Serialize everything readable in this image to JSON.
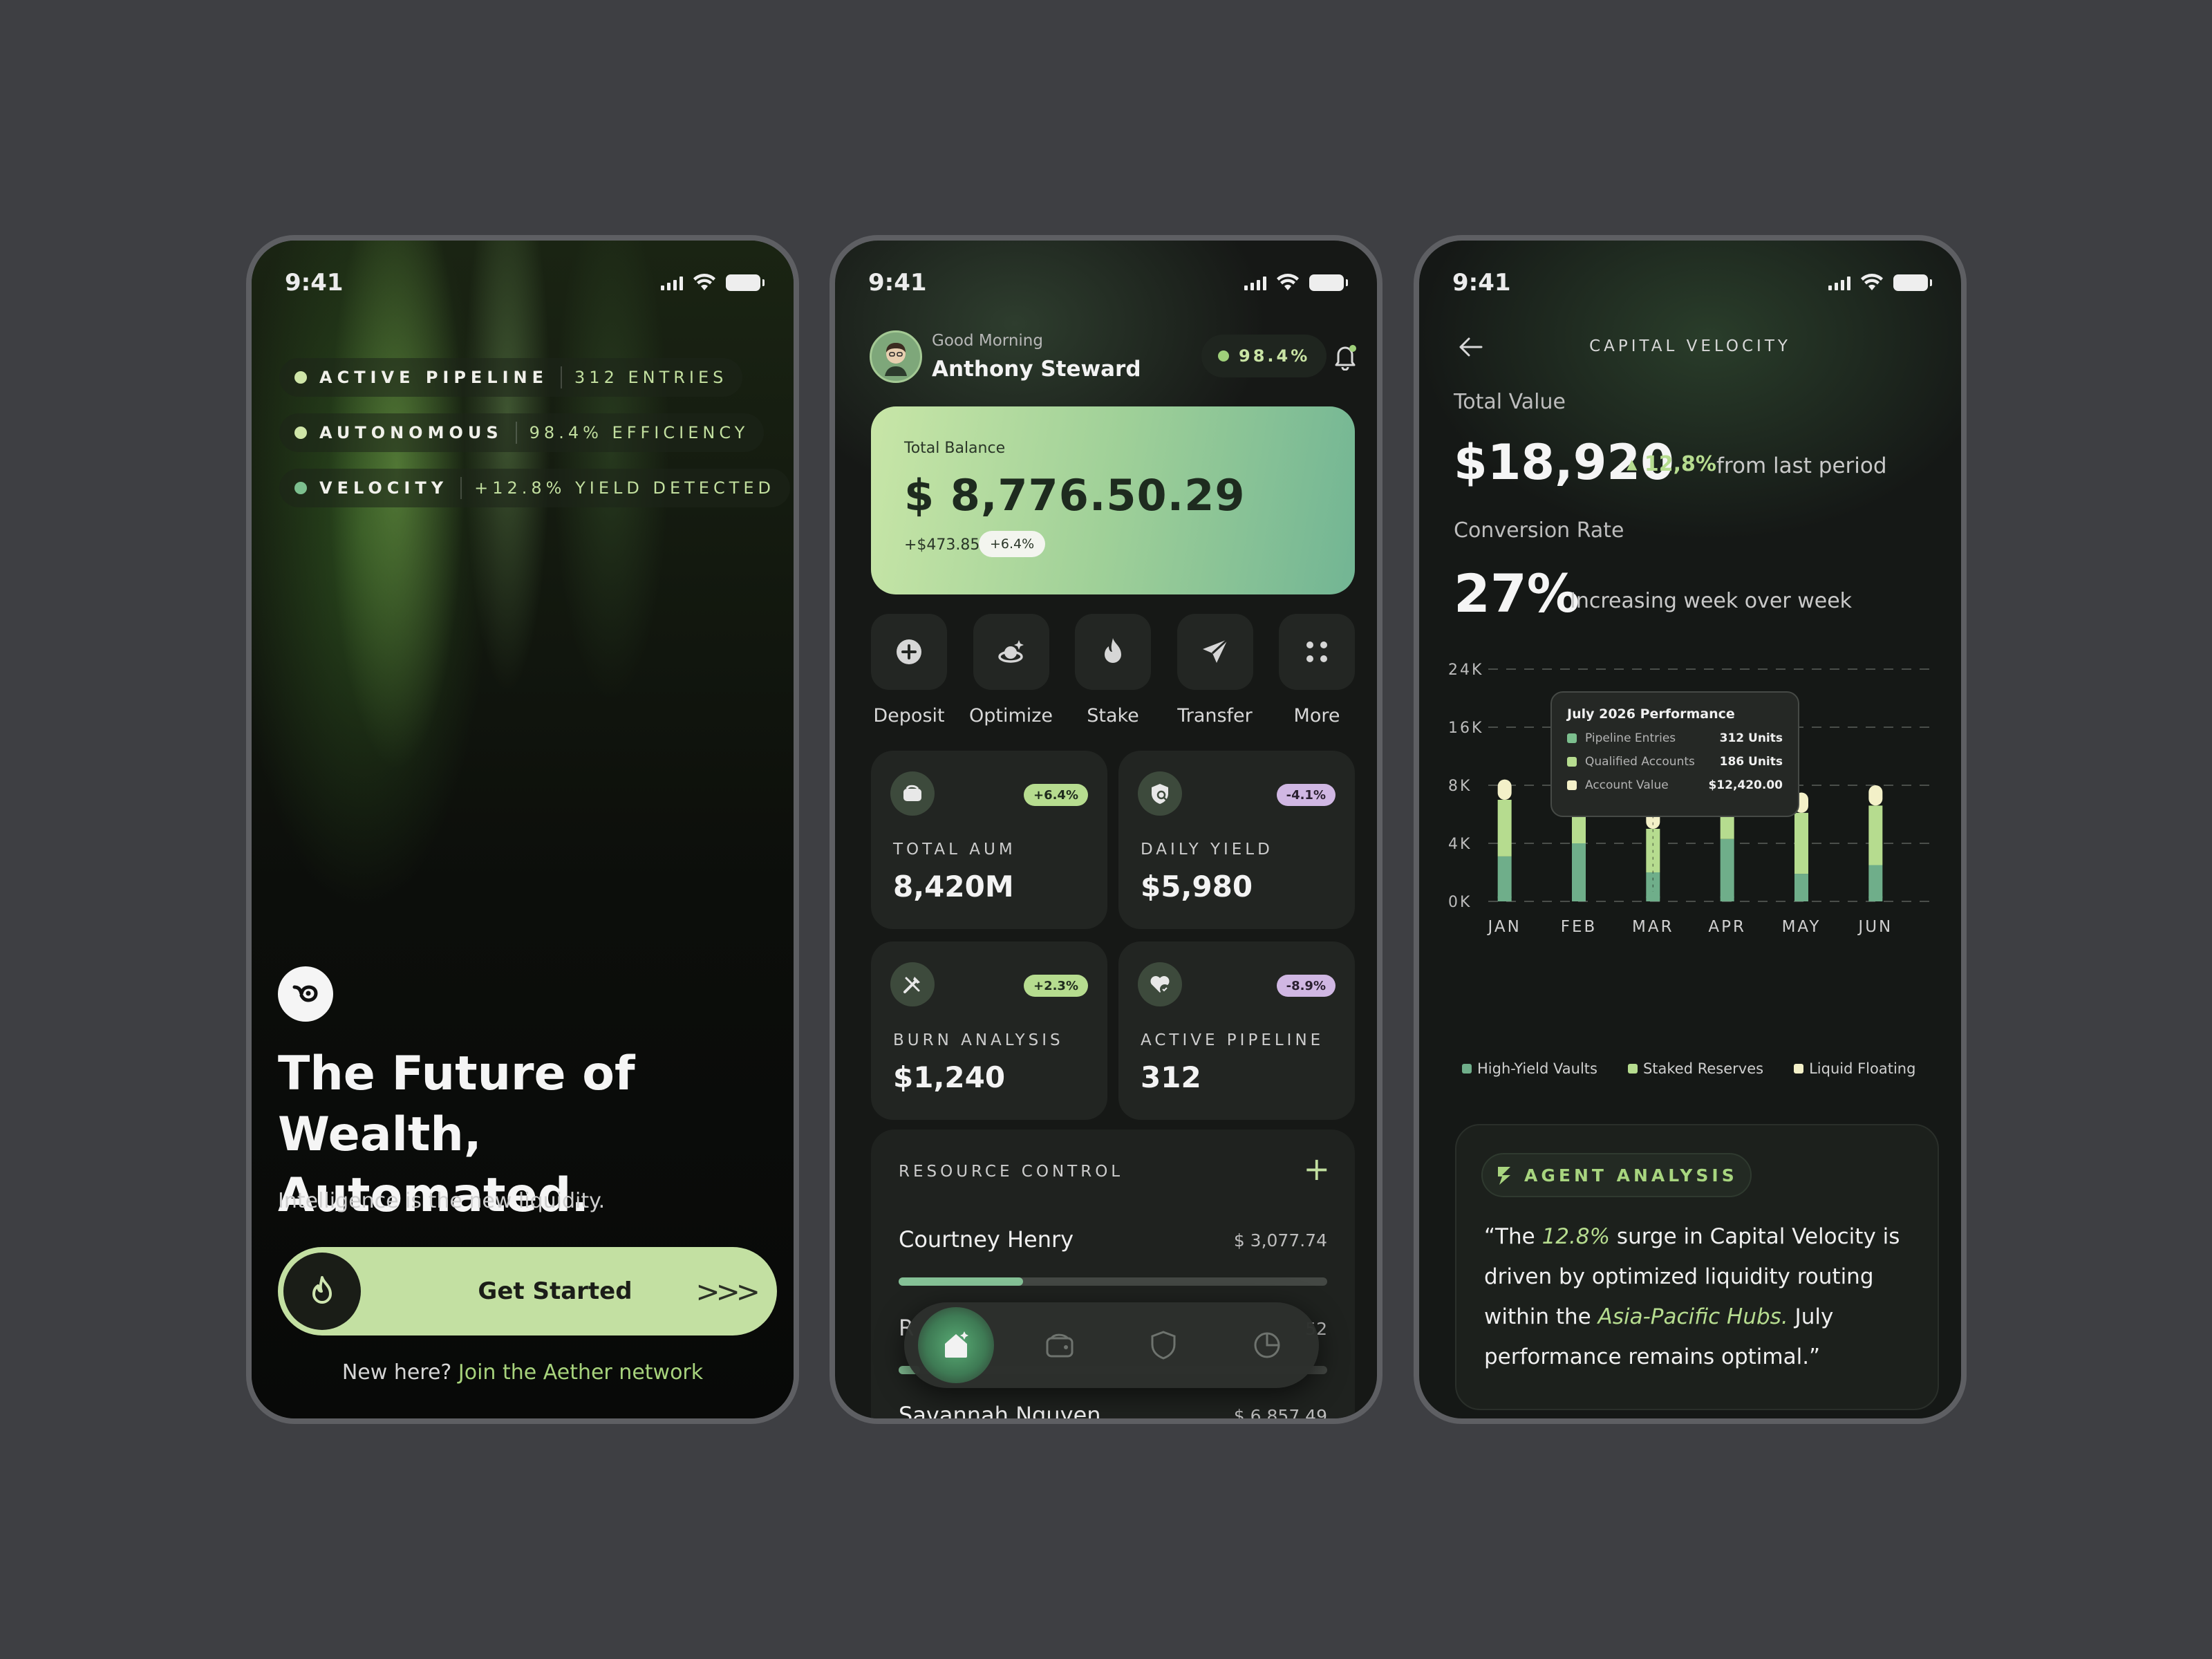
{
  "status": {
    "time": "9:41"
  },
  "onboarding": {
    "tags": [
      {
        "key": "ACTIVE PIPELINE",
        "value": "312 ENTRIES"
      },
      {
        "key": "AUTONOMOUS",
        "value": "98.4% EFFICIENCY"
      },
      {
        "key": "VELOCITY",
        "value": "+12.8% YIELD DETECTED"
      }
    ],
    "headline": "The Future of Wealth, Automated.",
    "subtitle": "Intelligence is the new liquidity.",
    "cta_label": "Get Started",
    "cta_arrows": ">>>",
    "footer_prefix": "New here?",
    "footer_link": "Join the Aether network"
  },
  "dashboard": {
    "greeting": "Good Morning",
    "user_name": "Anthony Steward",
    "efficiency": "98.4%",
    "balance": {
      "label": "Total Balance",
      "value": "$ 8,776.50.29",
      "change": "+$473.85",
      "change_pct": "+6.4%"
    },
    "actions": [
      {
        "label": "Deposit",
        "icon": "plus-circle-icon"
      },
      {
        "label": "Optimize",
        "icon": "optimize-icon"
      },
      {
        "label": "Stake",
        "icon": "flame-icon"
      },
      {
        "label": "Transfer",
        "icon": "send-icon"
      },
      {
        "label": "More",
        "icon": "grid-dots-icon"
      }
    ],
    "cards": [
      {
        "label": "TOTAL AUM",
        "value": "8,420M",
        "badge": "+6.4%",
        "tone": "up"
      },
      {
        "label": "DAILY YIELD",
        "value": "$5,980",
        "badge": "-4.1%",
        "tone": "down"
      },
      {
        "label": "BURN ANALYSIS",
        "value": "$1,240",
        "badge": "+2.3%",
        "tone": "up"
      },
      {
        "label": "ACTIVE PIPELINE",
        "value": "312",
        "badge": "-8.9%",
        "tone": "down"
      }
    ],
    "resource": {
      "title": "RESOURCE CONTROL",
      "rows": [
        {
          "name": "Courtney Henry",
          "amount": "$ 3,077.74",
          "progress": 0.29
        },
        {
          "name": "R",
          "amount": "52",
          "progress": 0.05
        },
        {
          "name": "Savannah Nguyen",
          "amount": "$ 6,857.49",
          "progress": 0.5
        }
      ]
    },
    "nav": [
      "home-icon",
      "wallet-icon",
      "shield-icon",
      "pie-chart-icon"
    ]
  },
  "analytics": {
    "title": "CAPITAL VELOCITY",
    "total_label": "Total Value",
    "total_value": "$18,920",
    "total_change": "12,8%",
    "total_change_suffix": "from last period",
    "conversion_label": "Conversion Rate",
    "conversion_value": "27%",
    "conversion_note": "Increasing week over week",
    "tooltip": {
      "title": "July 2026 Performance",
      "rows": [
        {
          "label": "Pipeline Entries",
          "value": "312 Units",
          "color": "#7cbf8e"
        },
        {
          "label": "Qualified Accounts",
          "value": "186 Units",
          "color": "#b6dc8f"
        },
        {
          "label": "Account Value",
          "value": "$12,420.00",
          "color": "#f3f0c8"
        }
      ]
    },
    "agent": {
      "label": "AGENT ANALYSIS",
      "quote_a": "“The ",
      "quote_em1": "12.8%",
      "quote_b": " surge in Capital Velocity is driven by optimized liquidity routing within the ",
      "quote_em2": "Asia-Pacific Hubs.",
      "quote_c": " July performance remains optimal.”"
    }
  },
  "chart_data": {
    "type": "bar",
    "stacked": true,
    "categories": [
      "JAN",
      "FEB",
      "MAR",
      "APR",
      "MAY",
      "JUN"
    ],
    "y_ticks": [
      "0K",
      "4K",
      "8K",
      "16K",
      "24K"
    ],
    "y_tick_values": [
      0,
      4,
      8,
      16,
      24
    ],
    "series": [
      {
        "name": "High-Yield Vaults",
        "color": "#6fae8a",
        "values": [
          3.1,
          4.0,
          2.0,
          4.3,
          1.9,
          2.5
        ]
      },
      {
        "name": "Staked Reserves",
        "color": "#b6dc8f",
        "values": [
          3.9,
          5.6,
          3.0,
          5.2,
          4.2,
          4.1
        ]
      },
      {
        "name": "Liquid Floating",
        "color": "#f3f0c8",
        "values": [
          1.8,
          1.3,
          1.4,
          1.5,
          1.4,
          1.4
        ]
      }
    ],
    "highlight": {
      "category": "MAR",
      "marker": true
    },
    "ylim": [
      0,
      24
    ],
    "grid": true,
    "legend": "bottom"
  }
}
